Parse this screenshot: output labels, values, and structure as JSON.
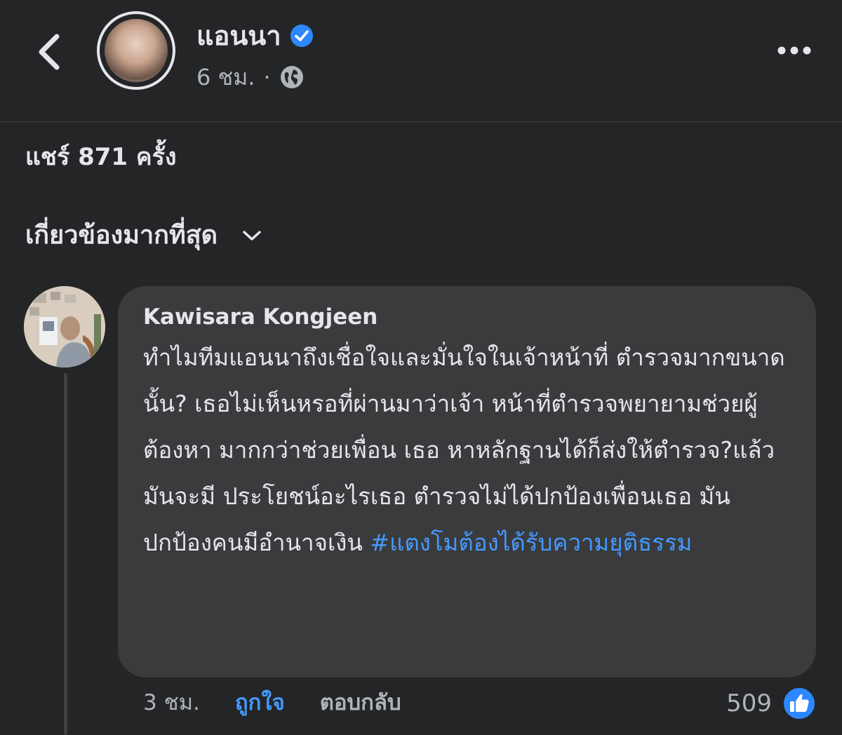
{
  "header": {
    "page_name": "แอนนา",
    "time": "6 ชม.",
    "separator": "·"
  },
  "post": {
    "share_count": "แชร์ 871 ครั้ง"
  },
  "comments_section": {
    "sort_label": "เกี่ยวข้องมากที่สุด"
  },
  "comment": {
    "author": "Kawisara Kongjeen",
    "text": "ทำไมทีมแอนนาถึงเชื่อใจและมั่นใจในเจ้าหน้าที่ ตำรวจมากขนาดนั้น? เธอไม่เห็นหรอที่ผ่านมาว่าเจ้า หน้าที่ตำรวจพยายามช่วยผู้ต้องหา มากกว่าช่วยเพื่อน เธอ หาหลักฐานได้ก็ส่งให้ตำรวจ?แล้วมันจะมี ประโยชน์อะไรเธอ ตำรวจไม่ได้ปกป้องเพื่อนเธอ มัน ปกป้องคนมีอำนาจเงิน ",
    "hashtag": "#แตงโมต้องได้รับความยุติธรรม",
    "time": "3 ชม.",
    "like_label": "ถูกใจ",
    "reply_label": "ตอบกลับ",
    "reaction_count": "509"
  },
  "colors": {
    "background": "#242526",
    "bubble": "#3a3b3c",
    "accent": "#4599ff",
    "verified": "#2d88ff",
    "text_primary": "#e4e6eb",
    "text_secondary": "#b0b3b8"
  }
}
